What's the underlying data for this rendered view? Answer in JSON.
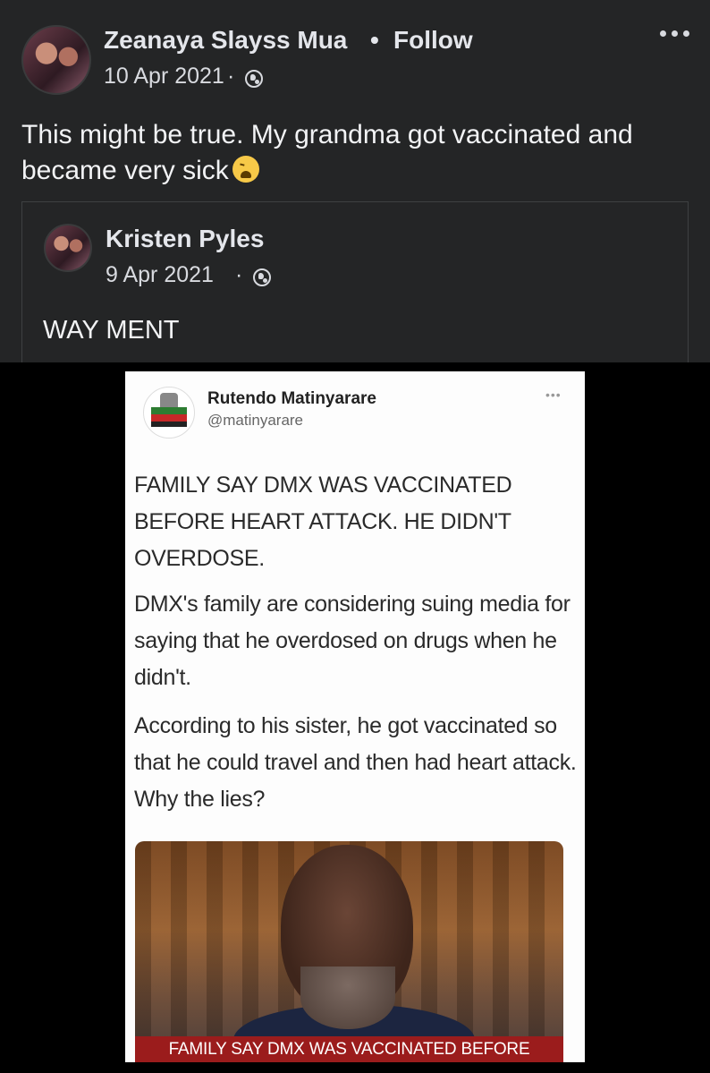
{
  "post": {
    "author": "Zeanaya Slayss Mua",
    "separator": "•",
    "follow_label": "Follow",
    "date": "10 Apr 2021",
    "date_sep": "·",
    "privacy_icon": "globe-icon",
    "more_icon": "more-options-icon",
    "text": "This might be true. My grandma got vaccinated and became very sick",
    "emoji": "weary-face-emoji"
  },
  "shared": {
    "author": "Kristen Pyles",
    "date": "9 Apr 2021",
    "date_sep": "·",
    "privacy_icon": "globe-icon",
    "text": "WAY MENT"
  },
  "tweet": {
    "name": "Rutendo Matinyarare",
    "handle": "@matinyarare",
    "more": "•••",
    "paragraphs": [
      "FAMILY SAY DMX WAS VACCINATED BEFORE HEART ATTACK. HE DIDN'T OVERDOSE.",
      "DMX's family are considering suing media for saying that he overdosed on drugs when he didn't.",
      "According to his sister, he got vaccinated so that he could travel and then had heart attack. Why the lies?"
    ],
    "photo_caption": "FAMILY SAY DMX WAS VACCINATED BEFORE"
  },
  "colors": {
    "post_bg": "#242526",
    "text_primary": "#e4e6eb",
    "caption_red": "#9b1c1c"
  }
}
